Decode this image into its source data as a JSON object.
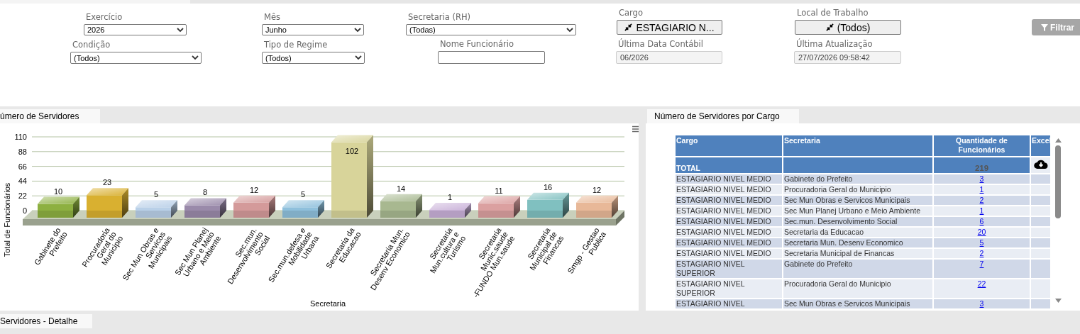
{
  "filters": [
    {
      "label": "Exercício",
      "kind": "select",
      "value": "2026"
    },
    {
      "label": "Mês",
      "kind": "select",
      "value": "Junho"
    },
    {
      "label": "Secretaria (RH)",
      "kind": "select",
      "value": "(Todas)"
    },
    {
      "label": "Cargo",
      "kind": "picker",
      "value": "ESTAGIARIO N..."
    },
    {
      "label": "Local de Trabalho",
      "kind": "picker",
      "value": "(Todos)"
    },
    {
      "label": "Condição",
      "kind": "select",
      "value": "(Todos)"
    },
    {
      "label": "Tipo de Regime",
      "kind": "select",
      "value": "(Todos)"
    },
    {
      "label": "Nome Funcionário",
      "kind": "text"
    },
    {
      "label": "Última Data Contábil",
      "kind": "readonly",
      "value": "06/2026"
    },
    {
      "label": "Última Atualização",
      "kind": "readonly",
      "value": "27/07/2026 09:58:42"
    }
  ],
  "filter_button": {
    "label": "Filtrar"
  },
  "chart_panel": {
    "tab": "úmero de Servidores",
    "chart_data": {
      "type": "bar",
      "xlabel": "Secretaria",
      "ylabel": "Total de Funcionários",
      "categories": [
        "Gabinete do Prefeito",
        "Procuradoria Geral do Municipio",
        "Sec Mun Obras e Servicos Municipais",
        "Sec Mun Planej Urbano e Meio Ambiente",
        "Sec.mun. Desenvolvimento Social",
        "Sec.mun.defesa e Mobilidade Urbana",
        "Secretaria da Educacao",
        "Secretaria Mun. Desenv Economico",
        "Secretaria Mun.cultura e Turismo",
        "Secretaria Munic.saude -FUNDO Mun.saude",
        "Secretaria Municipal de Financas",
        "Smgp - Gestao Publica"
      ],
      "values": [
        10,
        23,
        5,
        8,
        12,
        5,
        102,
        14,
        1,
        11,
        16,
        12
      ],
      "yticks": [
        0,
        22,
        44,
        66,
        88,
        110
      ],
      "ylim": [
        0,
        110
      ],
      "grid": true,
      "data_labels": true
    }
  },
  "table_panel": {
    "tab": "Número de Servidores por Cargo",
    "columns": [
      "Cargo",
      "Secretaria",
      "Quantidade de Funcionários",
      "Excel"
    ],
    "total": {
      "label": "TOTAL",
      "value": "219"
    },
    "rows": [
      {
        "cargo": "ESTAGIARIO NIVEL MEDIO",
        "secretaria": "Gabinete do Prefeito",
        "quantidade": "3"
      },
      {
        "cargo": "ESTAGIARIO NIVEL MEDIO",
        "secretaria": "Procuradoria Geral do Municipio",
        "quantidade": "1"
      },
      {
        "cargo": "ESTAGIARIO NIVEL MEDIO",
        "secretaria": "Sec Mun Obras e Servicos Municipais",
        "quantidade": "2"
      },
      {
        "cargo": "ESTAGIARIO NIVEL MEDIO",
        "secretaria": "Sec Mun Planej Urbano e Meio Ambiente",
        "quantidade": "1"
      },
      {
        "cargo": "ESTAGIARIO NIVEL MEDIO",
        "secretaria": "Sec.mun. Desenvolvimento Social",
        "quantidade": "6"
      },
      {
        "cargo": "ESTAGIARIO NIVEL MEDIO",
        "secretaria": "Secretaria da Educacao",
        "quantidade": "20"
      },
      {
        "cargo": "ESTAGIARIO NIVEL MEDIO",
        "secretaria": "Secretaria Mun. Desenv Economico",
        "quantidade": "5"
      },
      {
        "cargo": "ESTAGIARIO NIVEL MEDIO",
        "secretaria": "Secretaria Municipal de Financas",
        "quantidade": "2"
      },
      {
        "cargo": "ESTAGIARIO NIVEL SUPERIOR",
        "secretaria": "Gabinete do Prefeito",
        "quantidade": "7"
      },
      {
        "cargo": "ESTAGIARIO NIVEL SUPERIOR",
        "secretaria": "Procuradoria Geral do Municipio",
        "quantidade": "22"
      },
      {
        "cargo": "ESTAGIARIO NIVEL",
        "secretaria": "Sec Mun Obras e Servicos Municipais",
        "quantidade": "3"
      }
    ]
  },
  "bottom_tab": {
    "label": "Servidores - Detalhe"
  }
}
